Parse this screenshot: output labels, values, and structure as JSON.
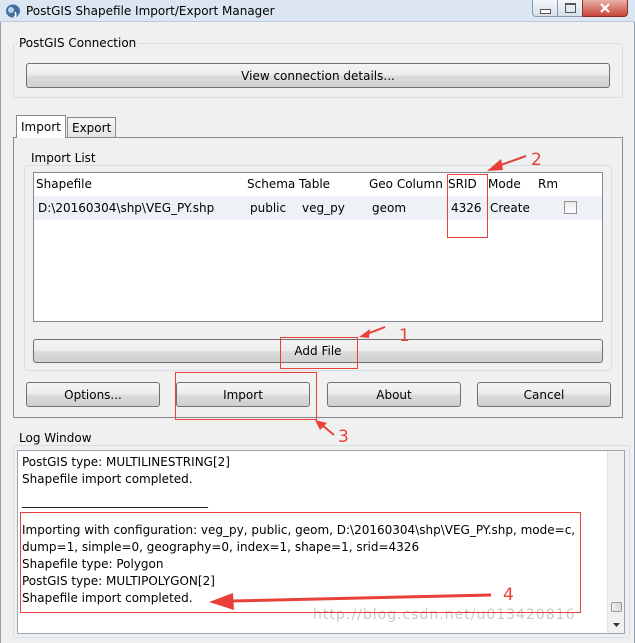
{
  "window": {
    "title": "PostGIS Shapefile Import/Export Manager"
  },
  "connection": {
    "group_label": "PostGIS Connection",
    "view_details_button": "View connection details..."
  },
  "tabs": [
    {
      "label": "Import",
      "active": true
    },
    {
      "label": "Export",
      "active": false
    }
  ],
  "import_list": {
    "group_label": "Import List",
    "columns": [
      "Shapefile",
      "Schema",
      "Table",
      "Geo Column",
      "SRID",
      "Mode",
      "Rm"
    ],
    "rows": [
      {
        "shapefile": "D:\\20160304\\shp\\VEG_PY.shp",
        "schema": "public",
        "table": "veg_py",
        "geo_column": "geom",
        "srid": "4326",
        "mode": "Create",
        "rm": false
      }
    ],
    "add_file_button": "Add File"
  },
  "buttons": {
    "options": "Options...",
    "import": "Import",
    "about": "About",
    "cancel": "Cancel"
  },
  "log": {
    "group_label": "Log Window",
    "lines": [
      "PostGIS type: MULTILINESTRING[2]",
      "Shapefile import completed.",
      "",
      "_______________________________",
      "Importing with configuration: veg_py, public, geom, D:\\20160304\\shp\\VEG_PY.shp, mode=c,",
      "dump=1, simple=0, geography=0, index=1, shape=1, srid=4326",
      "Shapefile type: Polygon",
      "PostGIS type: MULTIPOLYGON[2]",
      "Shapefile import completed."
    ]
  },
  "annotations": {
    "n1": "1",
    "n2": "2",
    "n3": "3",
    "n4": "4",
    "color": "#e8413a"
  },
  "watermark": "http://blog.csdn.net/u013420816",
  "colors": {
    "accent": "#e8413a",
    "titlebar": "#dce6f3",
    "close_button": "#c9463a"
  }
}
